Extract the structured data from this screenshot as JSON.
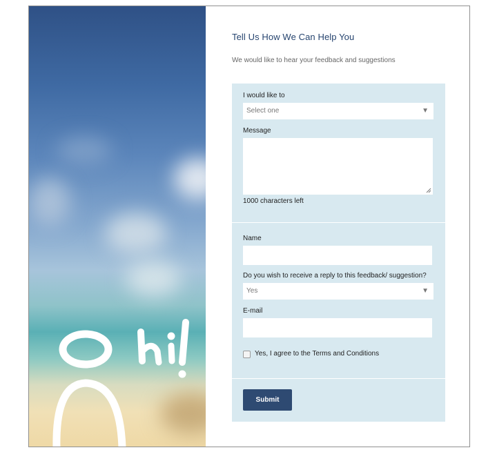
{
  "form": {
    "title": "Tell Us How We Can Help You",
    "subtitle": "We would like to hear your feedback and suggestions",
    "intent": {
      "label": "I would like to",
      "value": "Select one"
    },
    "message": {
      "label": "Message",
      "counter": "1000 characters left"
    },
    "name": {
      "label": "Name",
      "value": ""
    },
    "reply": {
      "label": "Do you wish to receive a reply to this feedback/ suggestion?",
      "value": "Yes"
    },
    "email": {
      "label": "E-mail",
      "value": ""
    },
    "terms": {
      "label": "Yes, I agree to the Terms and Conditions",
      "checked": false
    },
    "submit_label": "Submit"
  },
  "hero": {
    "doodle_text": "O hi!"
  },
  "colors": {
    "accent": "#2e4a72",
    "form_bg": "#d8e9f0",
    "title": "#26446f"
  }
}
